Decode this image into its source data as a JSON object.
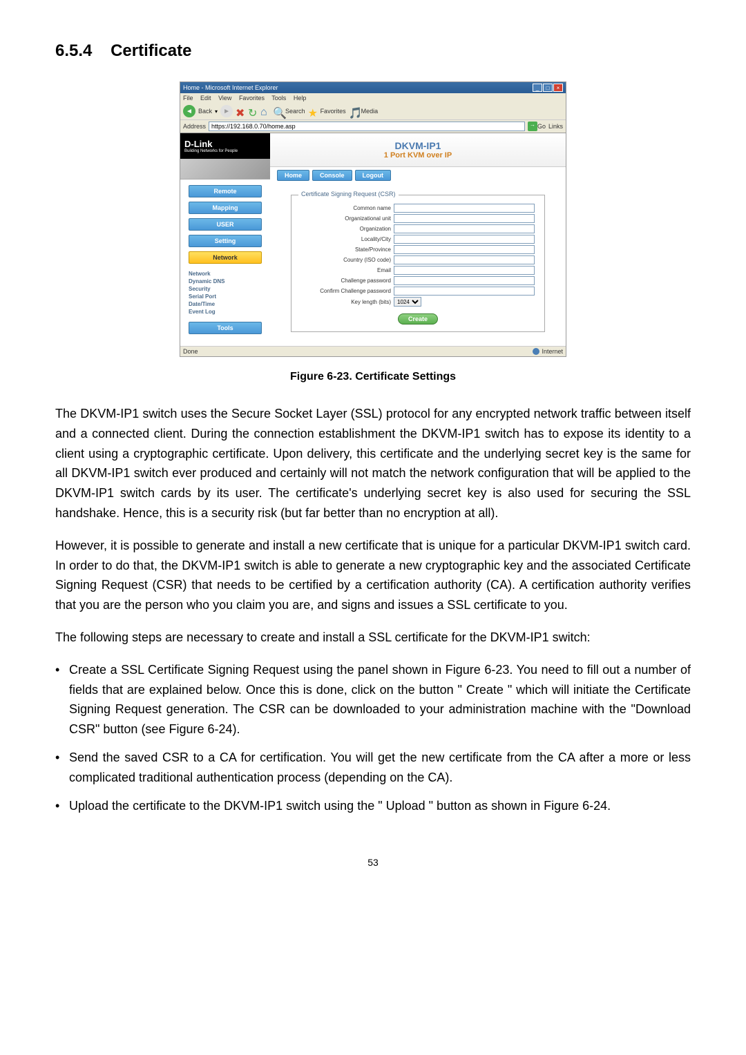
{
  "section": {
    "number": "6.5.4",
    "title": "Certificate"
  },
  "browser": {
    "title": "Home - Microsoft Internet Explorer",
    "menu": {
      "file": "File",
      "edit": "Edit",
      "view": "View",
      "favorites": "Favorites",
      "tools": "Tools",
      "help": "Help"
    },
    "toolbar": {
      "back": "Back",
      "search": "Search",
      "favorites": "Favorites",
      "media": "Media"
    },
    "address": {
      "label": "Address",
      "url": "https://192.168.0.70/home.asp",
      "go": "Go",
      "links": "Links"
    },
    "status": {
      "done": "Done",
      "zone": "Internet"
    }
  },
  "page": {
    "logo": "D-Link",
    "logo_sub": "Building Networks for People",
    "product": "DKVM-IP1",
    "product_sub": "1 Port KVM over IP",
    "tabs": {
      "home": "Home",
      "console": "Console",
      "logout": "Logout"
    },
    "sidebar": {
      "remote": "Remote",
      "mapping": "Mapping",
      "user": "USER",
      "setting": "Setting",
      "network": "Network",
      "tools": "Tools"
    },
    "sublinks": {
      "network": "Network",
      "dns": "Dynamic DNS",
      "security": "Security",
      "serial": "Serial Port",
      "datetime": "Date/Time",
      "eventlog": "Event Log"
    },
    "form": {
      "legend": "Certificate Signing Request (CSR)",
      "common_name": "Common name",
      "org_unit": "Organizational unit",
      "organization": "Organization",
      "locality": "Locality/City",
      "state": "State/Province",
      "country": "Country (ISO code)",
      "email": "Email",
      "challenge": "Challenge password",
      "confirm": "Confirm Challenge password",
      "keylength": "Key length (bits)",
      "keylength_value": "1024",
      "create": "Create"
    }
  },
  "figure": {
    "caption": "Figure 6-23. Certificate Settings"
  },
  "paragraphs": {
    "p1": "The DKVM-IP1 switch uses the Secure Socket Layer (SSL) protocol for any encrypted network traffic between itself and a connected client. During the connection establishment the DKVM-IP1 switch has to expose its identity to a client using a cryptographic certificate. Upon delivery, this certificate and the underlying secret key is the same for all DKVM-IP1 switch ever produced and certainly will not match the network configuration that will be applied to the DKVM-IP1 switch cards by its user. The certificate's underlying secret key is also used for securing the SSL handshake. Hence, this is a security risk (but far better than no encryption at all).",
    "p2": "However, it is possible to generate and install a new certificate that is unique for a particular DKVM-IP1 switch card. In order to do that, the DKVM-IP1 switch is able to generate a new cryptographic key and the associated Certificate Signing Request (CSR) that needs to be certified by a certification authority (CA). A certification authority verifies that you are the person who you claim you are, and signs and issues a SSL certificate to you.",
    "p3": "The following steps are necessary to create and install a SSL certificate for the DKVM-IP1 switch:"
  },
  "steps": {
    "s1": "Create a SSL Certificate Signing Request using the panel shown in Figure 6-23. You need to fill out a number of fields that are explained below. Once this is done, click on the button \" Create \" which will initiate the Certificate Signing Request generation. The CSR can be downloaded to your administration machine with the \"Download CSR\" button (see Figure 6-24).",
    "s2": "Send the saved CSR to a CA for certification. You will get the new certificate from the CA after a more or less complicated traditional authentication process (depending on the CA).",
    "s3": "Upload the certificate to the DKVM-IP1 switch using the \" Upload \" button as shown in Figure 6-24."
  },
  "page_number": "53"
}
